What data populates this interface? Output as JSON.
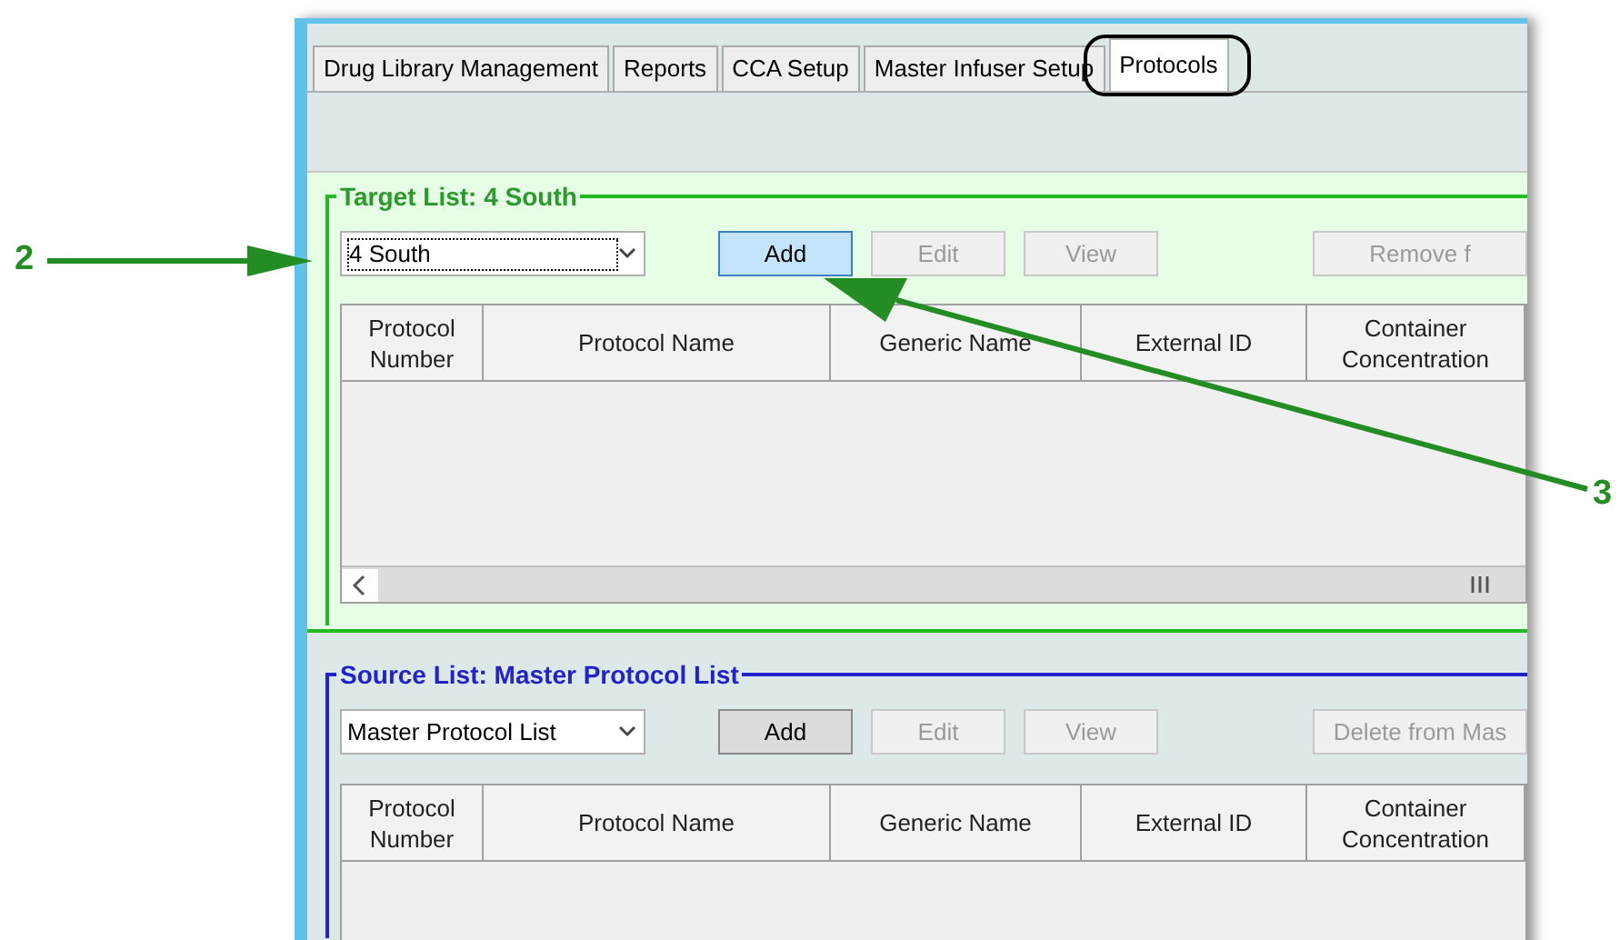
{
  "callouts": [
    {
      "label": "2"
    },
    {
      "label": "3"
    }
  ],
  "tabs": [
    {
      "label": "Drug Library Management",
      "selected": false
    },
    {
      "label": "Reports",
      "selected": false
    },
    {
      "label": "CCA Setup",
      "selected": false
    },
    {
      "label": "Master Infuser Setup",
      "selected": false
    },
    {
      "label": "Protocols",
      "selected": true,
      "circled": true
    }
  ],
  "target_list": {
    "title": "Target List: 4 South",
    "dropdown": "4 South",
    "buttons": [
      {
        "label": "Add",
        "disabled": false,
        "focused": true
      },
      {
        "label": "Edit",
        "disabled": true
      },
      {
        "label": "View",
        "disabled": true
      },
      {
        "label": "Remove f",
        "disabled": true
      }
    ],
    "columns": [
      "Protocol Number",
      "Protocol Name",
      "Generic Name",
      "External ID",
      "Container Concentration"
    ]
  },
  "source_list": {
    "title": "Source List: Master Protocol List",
    "dropdown": "Master Protocol List",
    "buttons": [
      {
        "label": "Add",
        "disabled": false,
        "focused": false
      },
      {
        "label": "Edit",
        "disabled": true
      },
      {
        "label": "View",
        "disabled": true
      },
      {
        "label": "Delete from Mas",
        "disabled": true
      }
    ],
    "columns": [
      "Protocol Number",
      "Protocol Name",
      "Generic Name",
      "External ID",
      "Container Concentration"
    ]
  }
}
